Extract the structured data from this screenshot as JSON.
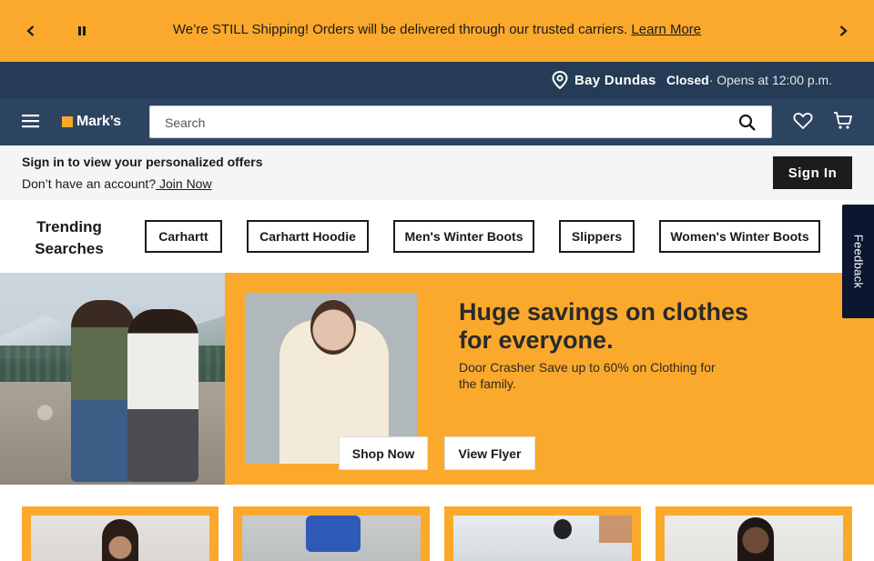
{
  "promo": {
    "message": "We’re STILL Shipping! Orders will be delivered through our trusted carriers.",
    "link": "Learn More"
  },
  "store": {
    "name": "Bay Dundas",
    "status": "Closed",
    "hours": "· Opens at 12:00 p.m."
  },
  "header": {
    "logo": "Mark’s",
    "search_placeholder": "Search"
  },
  "signin": {
    "headline": "Sign in to view your personalized offers",
    "prompt": "Don’t have an account?",
    "join_link": " Join Now",
    "button": "Sign In"
  },
  "trending": {
    "title": "Trending Searches",
    "chips": [
      "Carhartt",
      "Carhartt Hoodie",
      "Men's Winter Boots",
      "Slippers",
      "Women's Winter Boots"
    ]
  },
  "feedback": "Feedback",
  "hero": {
    "headline": "Huge savings on clothes for everyone.",
    "subline": "Door Crasher Save up to 60% on Clothing for the family.",
    "shop_now": "Shop Now",
    "view_flyer": "View Flyer"
  },
  "colors": {
    "accent": "#fba92c",
    "navy": "#2d4461",
    "navy_dark": "#253b56"
  }
}
